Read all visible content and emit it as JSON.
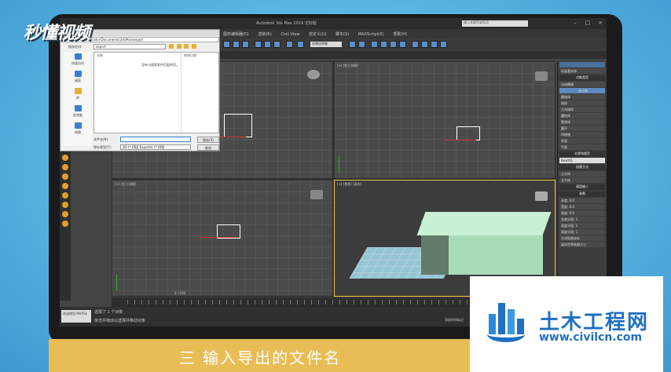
{
  "logo": {
    "text": "秒懂视频"
  },
  "app": {
    "title": "Autodesk 3ds Max 2019  无标题",
    "search_placeholder": "键入关键字或短语",
    "menus": [
      "图形编辑器(D)",
      "渲染(R)",
      "Civil View",
      "自定义(U)",
      "脚本(S)",
      "MAXScript(X)",
      "帮助(H)"
    ],
    "selection_set": "创建选择集"
  },
  "dialog": {
    "title": "选择要导出的文件",
    "path": "C:\\Users\\Administrator\\Documents\\3dsMax\\export",
    "look_in_label": "保存在(I):",
    "look_in_value": "export",
    "places": [
      "快速访问",
      "桌面",
      "库",
      "此电脑",
      "网络"
    ],
    "col_name": "名称",
    "col_date": "修改日期",
    "empty_msg": "没有与搜索条件匹配的项。",
    "filename_label": "文件名(N):",
    "filename_value": "",
    "filetype_label": "保存类型(T):",
    "filetype_value": "3D (*.OBJ) Exporter (*.OBJ)",
    "save_label": "保存(S)",
    "cancel_label": "取消"
  },
  "viewports": {
    "top_right_label": "[+] [前] [线框]",
    "bottom_left_label": "[+] [左] [线框]",
    "persp_label": "[+] [透视] [真实]"
  },
  "command_panel": {
    "category": "标准基本体",
    "object_type_header": "对象类型",
    "autogrid": "自动栅格",
    "buttons": [
      "长方体",
      "圆锥体",
      "球体",
      "几何球体",
      "圆柱体",
      "管状体",
      "圆环",
      "四棱锥",
      "茶壶",
      "平面"
    ],
    "name_color_header": "名称和颜色",
    "name_value": "Box001",
    "creation_method_header": "创建方法",
    "creation_cube": "立方体",
    "creation_box": "长方体",
    "keyboard_header": "键盘输入",
    "params_header": "参数",
    "length": "长度: 0.0",
    "width": "宽度: 0.0",
    "height": "高度: 0.0",
    "length_segs": "长度分段: 1",
    "width_segs": "宽度分段: 1",
    "height_segs": "高度分段: 1",
    "gen_uv": "生成贴图坐标",
    "real_world": "真实世界贴图大小"
  },
  "timeline": {
    "frame": "0 / 100"
  },
  "status": {
    "mini_listener": "欢迎使用 MAXSc",
    "selected": "选择了 1 个对象",
    "hint": "单击并拖动以选择并移动对象",
    "add_time_tag": "添加时间标记"
  },
  "caption": {
    "text": "三 输入导出的文件名"
  },
  "watermark": {
    "name": "土木工程网",
    "url": "www.civilcn.com"
  }
}
